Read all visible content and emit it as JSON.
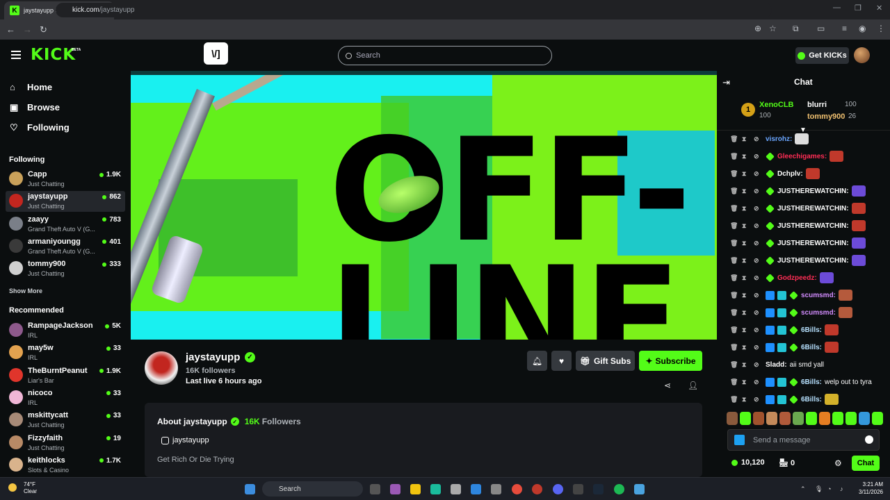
{
  "browser": {
    "tab_title": "jaystayupp Stream - Watch Live",
    "url_domain": "kick.com",
    "url_path": "/jaystayupp"
  },
  "header": {
    "logo": "KICK",
    "beta": "BETA",
    "v_button": "\\/]",
    "search_placeholder": "Search",
    "get_kicks": "Get KICKs"
  },
  "sidebar": {
    "nav": [
      {
        "label": "Home",
        "icon": "home-icon"
      },
      {
        "label": "Browse",
        "icon": "browse-icon"
      },
      {
        "label": "Following",
        "icon": "heart-icon"
      }
    ],
    "following_heading": "Following",
    "following": [
      {
        "name": "Capp",
        "category": "Just Chatting",
        "viewers": "1.9K",
        "color": "#c9a15a"
      },
      {
        "name": "jaystayupp",
        "category": "Just Chatting",
        "viewers": "862",
        "color": "#c2261f"
      },
      {
        "name": "zaayy",
        "category": "Grand Theft Auto V (G...",
        "viewers": "783",
        "color": "#7a7f88"
      },
      {
        "name": "armaniyoungg",
        "category": "Grand Theft Auto V (G...",
        "viewers": "401",
        "color": "#3a3a3a"
      },
      {
        "name": "tommy900",
        "category": "Just Chatting",
        "viewers": "333",
        "color": "#cfcfcf"
      }
    ],
    "show_more": "Show More",
    "recommended_heading": "Recommended",
    "recommended": [
      {
        "name": "RampageJackson",
        "category": "IRL",
        "viewers": "5K",
        "color": "#8e5a8c"
      },
      {
        "name": "may5w",
        "category": "IRL",
        "viewers": "33",
        "color": "#e3a24f"
      },
      {
        "name": "TheBurntPeanut",
        "category": "Liar's Bar",
        "viewers": "1.9K",
        "color": "#e0352b"
      },
      {
        "name": "nicoco",
        "category": "IRL",
        "viewers": "33",
        "color": "#f0b6d6"
      },
      {
        "name": "mskittycatt",
        "category": "Just Chatting",
        "viewers": "33",
        "color": "#a78a77"
      },
      {
        "name": "Fizzyfaith",
        "category": "Just Chatting",
        "viewers": "19",
        "color": "#b88a66"
      },
      {
        "name": "keithlocks",
        "category": "Slots & Casino",
        "viewers": "1.7K",
        "color": "#d9b38c"
      }
    ]
  },
  "video": {
    "offline_line1": "OFF-",
    "offline_line2": "LINE"
  },
  "channel": {
    "name": "jaystayupp",
    "followers": "16K followers",
    "last_live": "Last live 6 hours ago",
    "gift_subs": "Gift Subs",
    "subscribe": "Subscribe"
  },
  "about": {
    "title": "About jaystayupp",
    "followers_count": "16K",
    "followers_label": "Followers",
    "instagram": "jaystayupp",
    "bio": "Get Rich Or Die Trying"
  },
  "chat": {
    "title": "Chat",
    "leaderboard": [
      {
        "rank": "1",
        "name": "XenoCLB",
        "value": "100"
      },
      {
        "name": "blurri",
        "value": "100"
      },
      {
        "name": "tommy900",
        "value": "26"
      }
    ],
    "messages": [
      {
        "user": "visrohz:",
        "color": "#6aa6ff",
        "emote": "#ddd",
        "badges": 0
      },
      {
        "user": "Gleechigames:",
        "color": "#ff2d55",
        "emote": "#c0392b",
        "badges": 1
      },
      {
        "user": "Dchplv:",
        "color": "#ffffff",
        "emote": "#c0392b",
        "badges": 1
      },
      {
        "user": "JUSTHEREWATCHIN:",
        "color": "#ffffff",
        "emote": "#6c4bd8",
        "badges": 1
      },
      {
        "user": "JUSTHEREWATCHIN:",
        "color": "#ffffff",
        "emote": "#c0392b",
        "badges": 1
      },
      {
        "user": "JUSTHEREWATCHIN:",
        "color": "#ffffff",
        "emote": "#c0392b",
        "badges": 1
      },
      {
        "user": "JUSTHEREWATCHIN:",
        "color": "#ffffff",
        "emote": "#6c4bd8",
        "badges": 1
      },
      {
        "user": "JUSTHEREWATCHIN:",
        "color": "#ffffff",
        "emote": "#6c4bd8",
        "badges": 1
      },
      {
        "user": "Godzpeedz:",
        "color": "#ff2d55",
        "emote": "#6c4bd8",
        "badges": 1
      },
      {
        "user": "scumsmd:",
        "color": "#d38cff",
        "emote": "#b55a3c",
        "badges": 3
      },
      {
        "user": "scumsmd:",
        "color": "#d38cff",
        "emote": "#b55a3c",
        "badges": 3
      },
      {
        "user": "6Bills:",
        "color": "#b7e1ff",
        "emote": "#c0392b",
        "badges": 3
      },
      {
        "user": "6Bills:",
        "color": "#b7e1ff",
        "emote": "#c0392b",
        "badges": 3
      },
      {
        "user": "Sladd:",
        "color": "#ffffff",
        "text": "aii smd yall",
        "badges": 0
      },
      {
        "user": "6Bills:",
        "color": "#b7e1ff",
        "text": "welp out to tyra",
        "badges": 3
      },
      {
        "user": "6Bills:",
        "color": "#b7e1ff",
        "emote": "#d4b12a",
        "badges": 3
      }
    ],
    "input_placeholder": "Send a message",
    "points": "10,120",
    "store_count": "0",
    "chat_button": "Chat"
  },
  "taskbar": {
    "temp": "74°F",
    "weather": "Clear",
    "search": "Search",
    "time": "3:21 AM",
    "date": "3/11/2026"
  },
  "colors": {
    "accent": "#53fc18",
    "background": "#0b0e0f",
    "panel": "#191b1f"
  }
}
